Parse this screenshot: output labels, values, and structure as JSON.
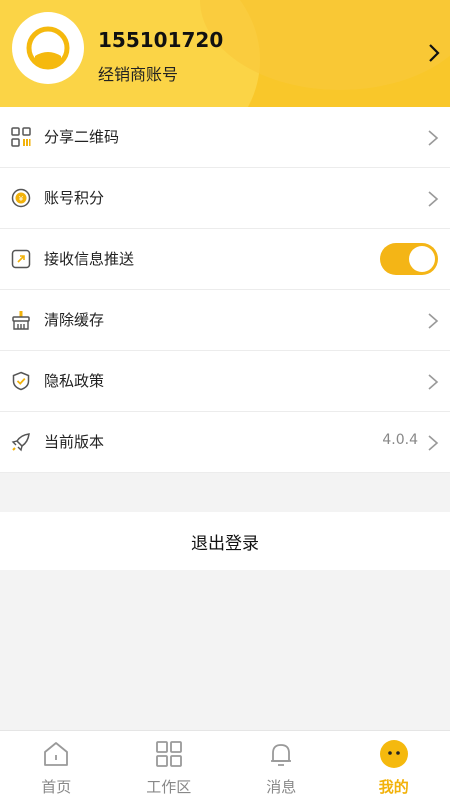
{
  "profile": {
    "user_id": "155101720",
    "role": "经销商账号"
  },
  "menu": {
    "items": [
      {
        "label": "分享二维码",
        "icon": "qrcode-icon"
      },
      {
        "label": "账号积分",
        "icon": "yen-coin-icon"
      },
      {
        "label": "接收信息推送",
        "icon": "push-icon",
        "toggle_on": true
      },
      {
        "label": "清除缓存",
        "icon": "broom-icon"
      },
      {
        "label": "隐私政策",
        "icon": "shield-check-icon"
      },
      {
        "label": "当前版本",
        "icon": "rocket-icon",
        "value": "4.0.4"
      }
    ]
  },
  "logout_label": "退出登录",
  "tabbar": {
    "tabs": [
      {
        "label": "首页",
        "icon": "home-icon"
      },
      {
        "label": "工作区",
        "icon": "grid-icon"
      },
      {
        "label": "消息",
        "icon": "bell-icon"
      },
      {
        "label": "我的",
        "icon": "face-icon",
        "active": true
      }
    ]
  },
  "colors": {
    "header_bg": "#f9c72a",
    "accent": "#f2b20a",
    "toggle_on": "#f4b516"
  }
}
